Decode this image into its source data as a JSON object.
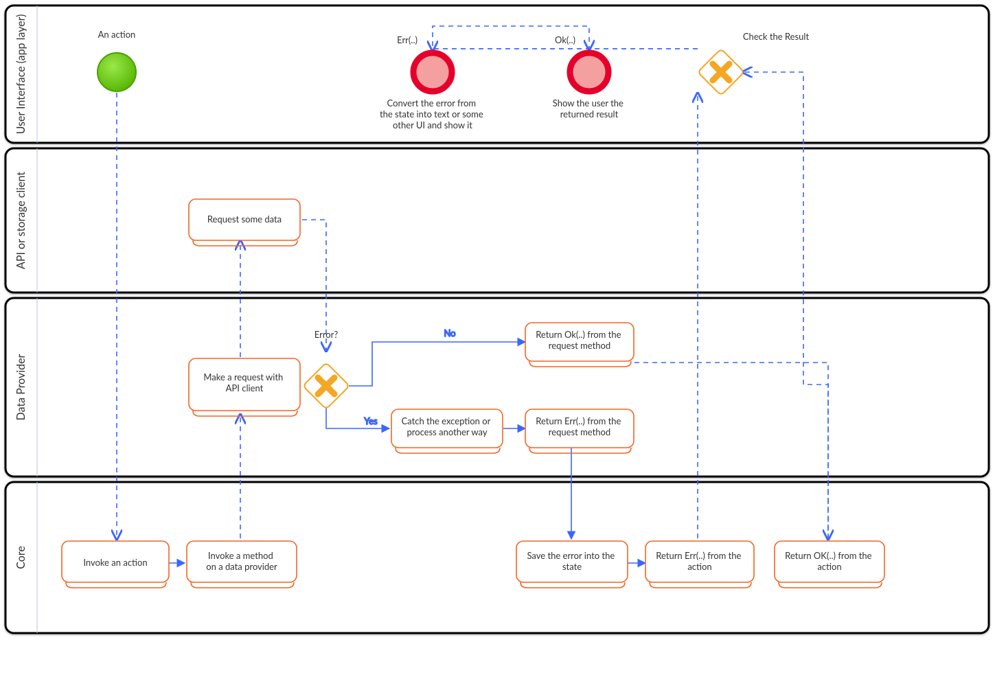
{
  "lanes": {
    "ui": {
      "title": "User Interface (app layer)"
    },
    "api": {
      "title": "API or storage client"
    },
    "dp": {
      "title": "Data Provider"
    },
    "core": {
      "title": "Core"
    }
  },
  "nodes": {
    "start": {
      "top_label": "An action"
    },
    "end_err": {
      "top_label": "Err(..)",
      "bottom_label": "Convert the error from the state into text or some other UI and show it"
    },
    "end_ok": {
      "top_label": "Ok(..)",
      "bottom_label": "Show the user the returned result"
    },
    "check_result": {
      "top_label": "Check the Result"
    },
    "request_data": {
      "label": "Request some data"
    },
    "make_request": {
      "label": "Make a request with API client"
    },
    "error_gate": {
      "top_label": "Error?"
    },
    "return_ok_req": {
      "label": "Return Ok(..) from the request method"
    },
    "catch_ex": {
      "label": "Catch the exception or process another way"
    },
    "return_err_req": {
      "label": "Return Err(..) from the request method"
    },
    "invoke_action": {
      "label": "Invoke an action"
    },
    "invoke_method": {
      "label": "Invoke a method on a data provider"
    },
    "save_error": {
      "label": "Save the error into the state"
    },
    "return_err_act": {
      "label": "Return Err(..) from the action"
    },
    "return_ok_act": {
      "label": "Return OK(..) from the action"
    }
  },
  "edges": {
    "no": {
      "label": "No"
    },
    "yes": {
      "label": "Yes"
    }
  },
  "colors": {
    "orange": "#f26522",
    "gold": "#f5a623",
    "red": "#e4002b",
    "pink": "#f5a0a0",
    "green1": "#7ed321",
    "green2": "#4aa000",
    "blue": "#3a66ff"
  }
}
